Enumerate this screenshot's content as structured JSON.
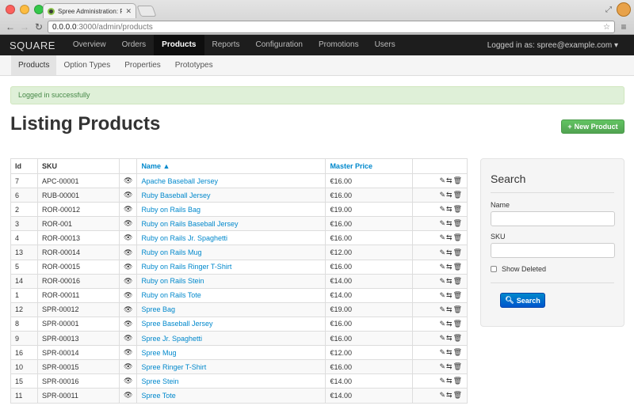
{
  "browser": {
    "tab_title": "Spree Administration: Pro",
    "url_host": "0.0.0.0",
    "url_rest": ":3000/admin/products"
  },
  "nav": {
    "brand": "SQUARE",
    "items": [
      "Overview",
      "Orders",
      "Products",
      "Reports",
      "Configuration",
      "Promotions",
      "Users"
    ],
    "active": "Products",
    "user": "Logged in as: spree@example.com ▾"
  },
  "subnav": {
    "items": [
      "Products",
      "Option Types",
      "Properties",
      "Prototypes"
    ],
    "active": "Products"
  },
  "flash": "Logged in successfully",
  "page_title": "Listing Products",
  "new_button": "New Product",
  "table": {
    "headers": {
      "id": "Id",
      "sku": "SKU",
      "name": "Name ▲",
      "price": "Master Price"
    },
    "rows": [
      {
        "id": "7",
        "sku": "APC-00001",
        "name": "Apache Baseball Jersey",
        "price": "€16.00"
      },
      {
        "id": "6",
        "sku": "RUB-00001",
        "name": "Ruby Baseball Jersey",
        "price": "€16.00"
      },
      {
        "id": "2",
        "sku": "ROR-00012",
        "name": "Ruby on Rails Bag",
        "price": "€19.00"
      },
      {
        "id": "3",
        "sku": "ROR-001",
        "name": "Ruby on Rails Baseball Jersey",
        "price": "€16.00"
      },
      {
        "id": "4",
        "sku": "ROR-00013",
        "name": "Ruby on Rails Jr. Spaghetti",
        "price": "€16.00"
      },
      {
        "id": "13",
        "sku": "ROR-00014",
        "name": "Ruby on Rails Mug",
        "price": "€12.00"
      },
      {
        "id": "5",
        "sku": "ROR-00015",
        "name": "Ruby on Rails Ringer T-Shirt",
        "price": "€16.00"
      },
      {
        "id": "14",
        "sku": "ROR-00016",
        "name": "Ruby on Rails Stein",
        "price": "€14.00"
      },
      {
        "id": "1",
        "sku": "ROR-00011",
        "name": "Ruby on Rails Tote",
        "price": "€14.00"
      },
      {
        "id": "12",
        "sku": "SPR-00012",
        "name": "Spree Bag",
        "price": "€19.00"
      },
      {
        "id": "8",
        "sku": "SPR-00001",
        "name": "Spree Baseball Jersey",
        "price": "€16.00"
      },
      {
        "id": "9",
        "sku": "SPR-00013",
        "name": "Spree Jr. Spaghetti",
        "price": "€16.00"
      },
      {
        "id": "16",
        "sku": "SPR-00014",
        "name": "Spree Mug",
        "price": "€12.00"
      },
      {
        "id": "10",
        "sku": "SPR-00015",
        "name": "Spree Ringer T-Shirt",
        "price": "€16.00"
      },
      {
        "id": "15",
        "sku": "SPR-00016",
        "name": "Spree Stein",
        "price": "€14.00"
      },
      {
        "id": "11",
        "sku": "SPR-00011",
        "name": "Spree Tote",
        "price": "€14.00"
      }
    ]
  },
  "search": {
    "title": "Search",
    "name_label": "Name",
    "sku_label": "SKU",
    "show_deleted_label": "Show Deleted",
    "button": "Search"
  },
  "colors": {
    "link": "#0088cc",
    "success": "#51a351",
    "flash_bg": "#dff0d8",
    "nav_bg": "#1d1d1d"
  }
}
